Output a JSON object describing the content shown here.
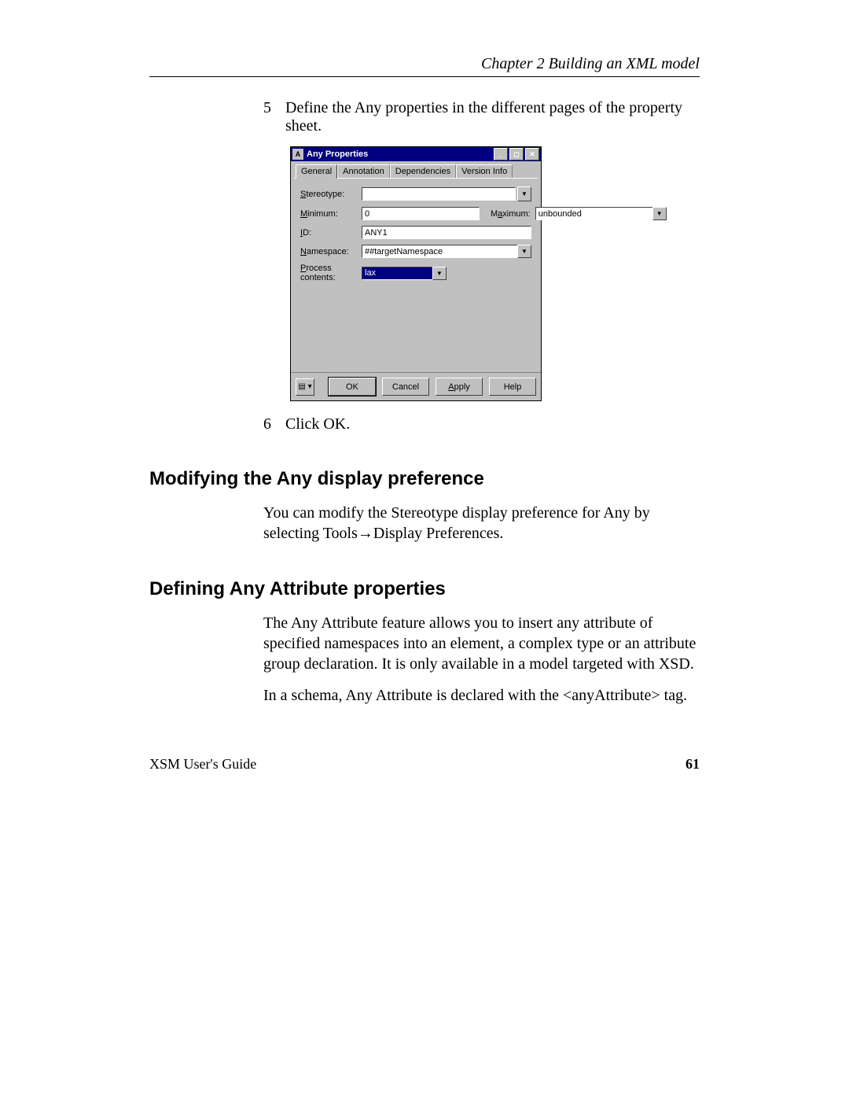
{
  "header": {
    "chapter": "Chapter 2  Building an XML model"
  },
  "steps": {
    "s5": {
      "num": "5",
      "text": "Define the Any properties in the different pages of the property sheet."
    },
    "s6": {
      "num": "6",
      "text": "Click OK."
    }
  },
  "dialog": {
    "title": "Any Properties",
    "tabs": {
      "t0": "General",
      "t1": "Annotation",
      "t2": "Dependencies",
      "t3": "Version Info"
    },
    "labels": {
      "stereotype": "Stereotype:",
      "minimum": "Minimum:",
      "maximum": "Maximum:",
      "id": "ID:",
      "namespace": "Namespace:",
      "process": "Process contents:"
    },
    "values": {
      "stereotype": "",
      "minimum": "0",
      "maximum": "unbounded",
      "id": "ANY1",
      "namespace": "##targetNamespace",
      "process": "lax"
    },
    "buttons": {
      "ok": "OK",
      "cancel": "Cancel",
      "apply": "Apply",
      "help": "Help"
    }
  },
  "section1": {
    "heading": "Modifying the Any display preference",
    "para": "You can modify the Stereotype display preference for Any by selecting Tools→Display Preferences."
  },
  "section2": {
    "heading": "Defining Any Attribute properties",
    "para1": "The Any Attribute feature allows you to insert any attribute of specified namespaces into an element, a complex type or an attribute group declaration. It is only available in a model targeted with XSD.",
    "para2": "In a schema, Any Attribute is declared with the <anyAttribute> tag."
  },
  "footer": {
    "guide": "XSM User's Guide",
    "page": "61"
  }
}
